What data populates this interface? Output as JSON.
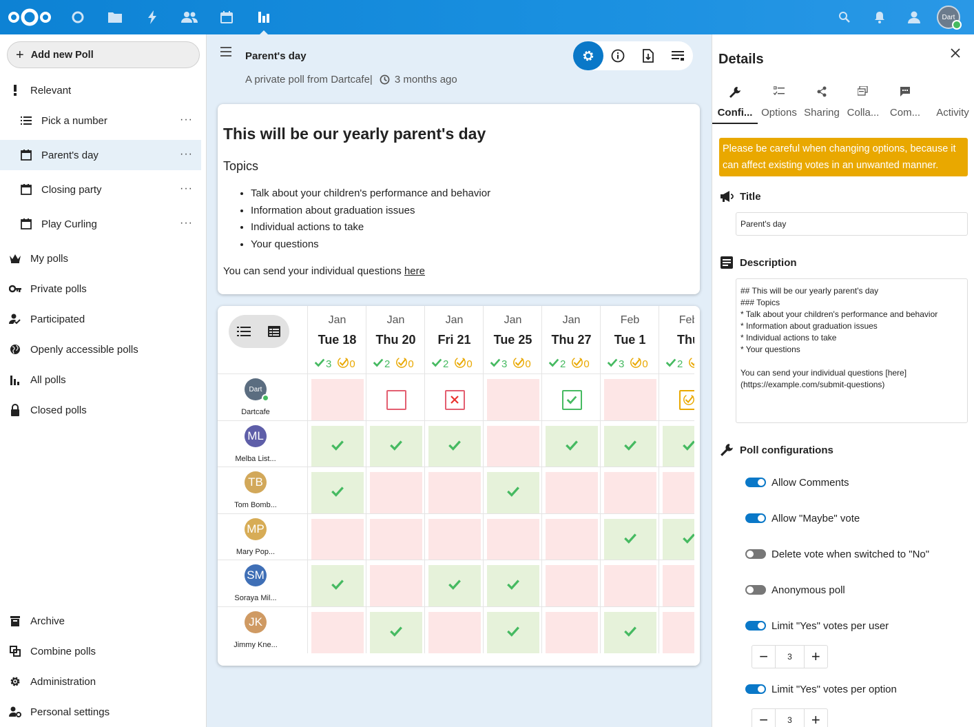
{
  "navigation": {
    "add_poll_label": "Add new Poll",
    "items": [
      {
        "label": "Relevant",
        "icon": "exclamation-icon"
      },
      {
        "label": "Pick a number",
        "icon": "list-icon"
      },
      {
        "label": "Parent's day",
        "icon": "calendar-icon"
      },
      {
        "label": "Closing party",
        "icon": "calendar-icon"
      },
      {
        "label": "Play Curling",
        "icon": "calendar-icon"
      },
      {
        "label": "My polls",
        "icon": "crown-icon"
      },
      {
        "label": "Private polls",
        "icon": "key-icon"
      },
      {
        "label": "Participated",
        "icon": "user-check-icon"
      },
      {
        "label": "Openly accessible polls",
        "icon": "globe-icon"
      },
      {
        "label": "All polls",
        "icon": "bar-chart-icon"
      },
      {
        "label": "Closed polls",
        "icon": "lock-icon"
      },
      {
        "label": "Archive",
        "icon": "archive-icon"
      },
      {
        "label": "Combine polls",
        "icon": "combine-icon"
      },
      {
        "label": "Administration",
        "icon": "gear-icon"
      },
      {
        "label": "Personal settings",
        "icon": "user-settings-icon"
      }
    ],
    "more_label": "···"
  },
  "header": {
    "avatar_text": "Dart"
  },
  "poll": {
    "title": "Parent's day",
    "subtitle": "A private poll from Dartcafe",
    "separator": "|",
    "time_ago": "3 months ago",
    "description": {
      "heading": "This will be our yearly parent's day",
      "subheading": "Topics",
      "bullets": [
        "Talk about your children's performance and behavior",
        "Information about graduation issues",
        "Individual actions to take",
        "Your questions"
      ],
      "para_text": "You can send your individual questions ",
      "link_text": "here"
    }
  },
  "grid": {
    "columns": [
      {
        "month": "Jan",
        "day": "Tue 18",
        "yes": "3",
        "maybe": "0"
      },
      {
        "month": "Jan",
        "day": "Thu 20",
        "yes": "2",
        "maybe": "0"
      },
      {
        "month": "Jan",
        "day": "Fri 21",
        "yes": "2",
        "maybe": "0"
      },
      {
        "month": "Jan",
        "day": "Tue 25",
        "yes": "3",
        "maybe": "0"
      },
      {
        "month": "Jan",
        "day": "Thu 27",
        "yes": "2",
        "maybe": "0"
      },
      {
        "month": "Feb",
        "day": "Tue 1",
        "yes": "3",
        "maybe": "0"
      },
      {
        "month": "Feb",
        "day": "Thu",
        "yes": "2",
        "maybe": ""
      }
    ],
    "users": [
      {
        "initials": "Dart",
        "name": "Dartcafe",
        "color": "#5b6d80",
        "votes": [
          "no",
          "empty",
          "no-x",
          "no",
          "yes-box",
          "no",
          "maybe-box"
        ]
      },
      {
        "initials": "ML",
        "name": "Melba List...",
        "color": "#5e5ea8",
        "votes": [
          "yes",
          "yes",
          "yes",
          "no",
          "yes",
          "yes",
          "yes"
        ]
      },
      {
        "initials": "TB",
        "name": "Tom Bomb...",
        "color": "#d2a85a",
        "votes": [
          "yes",
          "no",
          "no",
          "yes",
          "no",
          "no",
          "no"
        ]
      },
      {
        "initials": "MP",
        "name": "Mary Pop...",
        "color": "#d7ac56",
        "votes": [
          "no",
          "no",
          "no",
          "no",
          "no",
          "yes",
          "yes"
        ]
      },
      {
        "initials": "SM",
        "name": "Soraya Mil...",
        "color": "#3f6fb6",
        "votes": [
          "yes",
          "no",
          "yes",
          "yes",
          "no",
          "no",
          "no"
        ]
      },
      {
        "initials": "JK",
        "name": "Jimmy Kne...",
        "color": "#cf9a63",
        "votes": [
          "no",
          "yes",
          "no",
          "yes",
          "no",
          "yes",
          "no"
        ]
      }
    ]
  },
  "details": {
    "title": "Details",
    "tabs": [
      "Confi...",
      "Options",
      "Sharing",
      "Colla...",
      "Com...",
      "Activity"
    ],
    "warning": "Please be careful when changing options, because it can affect existing votes in an unwanted manner.",
    "title_label": "Title",
    "title_value": "Parent's day",
    "description_label": "Description",
    "description_value": "## This will be our yearly parent's day\n### Topics\n* Talk about your children's performance and behavior\n* Information about graduation issues\n* Individual actions to take\n* Your questions\n\nYou can send your individual questions [here]\n(https://example.com/submit-questions)",
    "config_label": "Poll configurations",
    "options": [
      {
        "label": "Allow Comments",
        "on": true
      },
      {
        "label": "Allow \"Maybe\" vote",
        "on": true
      },
      {
        "label": "Delete vote when switched to \"No\"",
        "on": false
      },
      {
        "label": "Anonymous poll",
        "on": false
      },
      {
        "label": "Limit \"Yes\" votes per user",
        "on": true
      },
      {
        "label": "Limit \"Yes\" votes per option",
        "on": true
      }
    ],
    "limit_user_value": "3",
    "limit_option_value": "3"
  },
  "colors": {
    "primary": "#0a78c8",
    "yes": "#46ba61",
    "maybe": "#e9a800",
    "no": "#e9322d",
    "warning": "#e9a800"
  }
}
